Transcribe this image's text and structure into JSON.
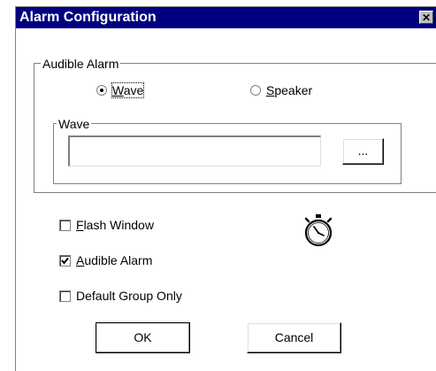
{
  "window": {
    "title": "Alarm Configuration",
    "close_glyph": "✕"
  },
  "audible_alarm_group": {
    "legend": "Audible Alarm",
    "radio_wave": {
      "label_accel": "W",
      "label_rest": "ave",
      "checked": true
    },
    "radio_speaker": {
      "label_accel": "S",
      "label_rest": "peaker",
      "checked": false
    }
  },
  "wave_group": {
    "legend": "Wave",
    "path_value": "",
    "browse_label": "..."
  },
  "options": {
    "flash_window": {
      "label_accel": "F",
      "label_rest": "lash Window",
      "checked": false
    },
    "audible_alarm": {
      "label_accel": "A",
      "label_rest": "udible Alarm",
      "checked": true
    },
    "default_group_only": {
      "label": "Default Group Only",
      "checked": false
    }
  },
  "icons": {
    "stopwatch": "stopwatch-icon"
  },
  "buttons": {
    "ok": "OK",
    "cancel": "Cancel"
  }
}
